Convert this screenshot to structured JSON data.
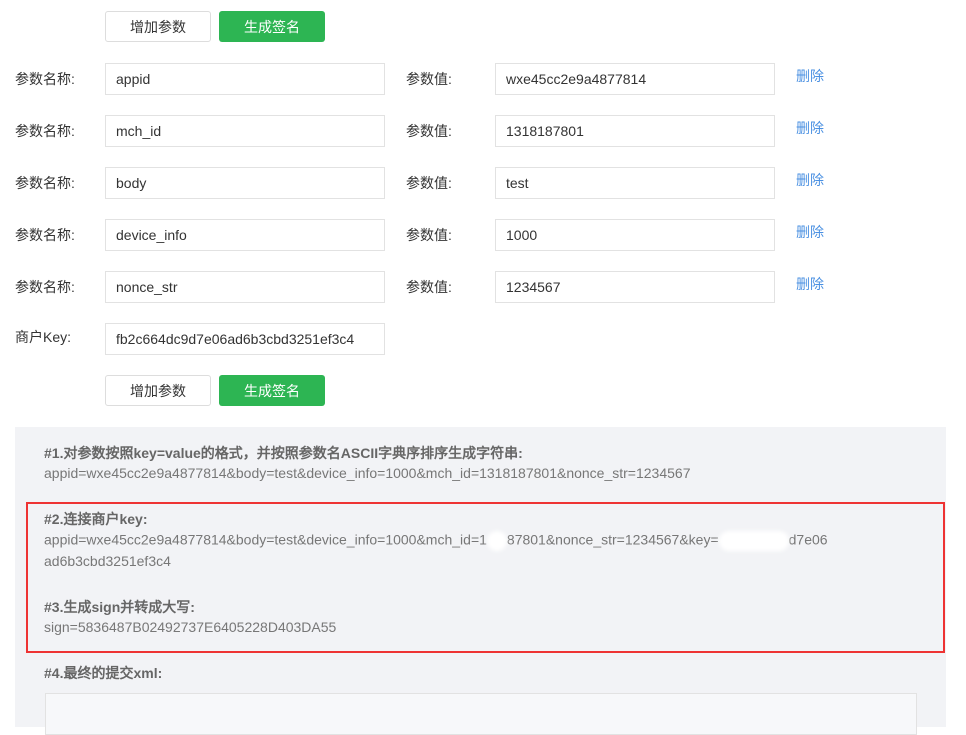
{
  "buttons": {
    "add": "增加参数",
    "generate": "生成签名"
  },
  "labels": {
    "name": "参数名称:",
    "value": "参数值:",
    "delete": "删除",
    "merchant_key": "商户Key:"
  },
  "params": [
    {
      "name": "appid",
      "value": "wxe45cc2e9a4877814"
    },
    {
      "name": "mch_id",
      "value": "1318187801"
    },
    {
      "name": "body",
      "value": "test"
    },
    {
      "name": "device_info",
      "value": "1000"
    },
    {
      "name": "nonce_str",
      "value": "1234567"
    }
  ],
  "merchant_key": "fb2c664dc9d7e06ad6b3cbd3251ef3c4",
  "steps": {
    "s1_title": "#1.对参数按照key=value的格式，并按照参数名ASCII字典序排序生成字符串:",
    "s1_text": "appid=wxe45cc2e9a4877814&body=test&device_info=1000&mch_id=1318187801&nonce_str=1234567",
    "s2_title": "#2.连接商户key:",
    "s2_part1": "appid=wxe45cc2e9a4877814&body=test&device_info=1000&mch_id=1",
    "s2_part2": "87801&nonce_str=1234567&key=",
    "s2_part3": "d7e06",
    "s2_line2": "ad6b3cbd3251ef3c4",
    "s3_title": "#3.生成sign并转成大写:",
    "s3_text": "sign=5836487B02492737E6405228D403DA55",
    "s4_title": "#4.最终的提交xml:"
  }
}
